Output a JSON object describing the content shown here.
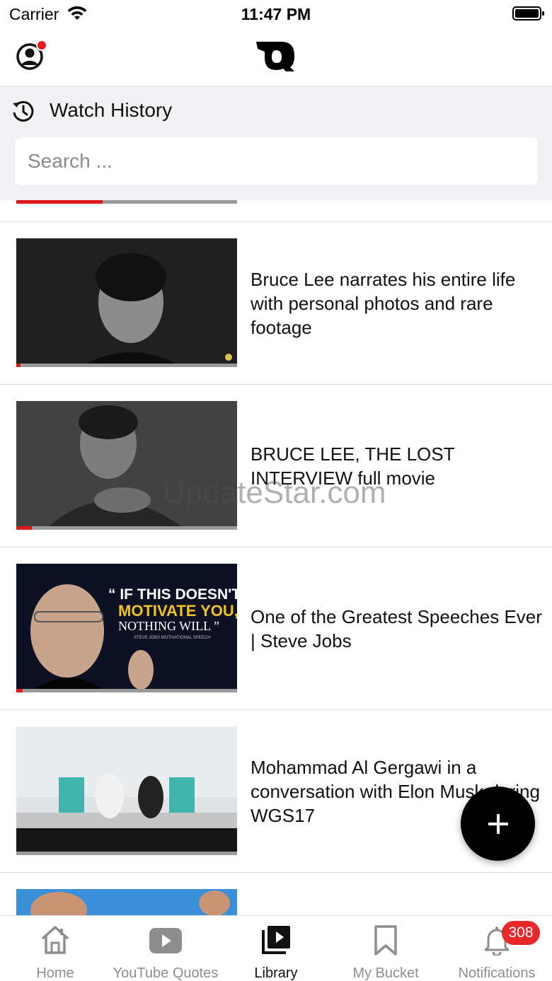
{
  "status_bar": {
    "carrier": "Carrier",
    "time": "11:47 PM"
  },
  "header": {
    "profile_icon": "user-circle-icon",
    "logo_icon": "app-logo-icon",
    "notification_dot_color": "#e81b1b"
  },
  "watch_history": {
    "title": "Watch History",
    "icon": "history-clock-icon"
  },
  "search": {
    "placeholder": "Search ..."
  },
  "partial_item": {
    "progress": 0.39
  },
  "videos": [
    {
      "title": "Bruce Lee narrates his entire life with personal photos and rare footage",
      "progress": 0.02
    },
    {
      "title": "BRUCE LEE, THE LOST INTERVIEW   full movie",
      "progress": 0.07
    },
    {
      "title": "One of the Greatest Speeches Ever | Steve Jobs",
      "progress": 0.03,
      "thumbnail_text": {
        "line1": "“ IF THIS DOESN'T",
        "line2": "MOTIVATE YOU,",
        "line3": "NOTHING WILL ”",
        "line4": "STEVE JOBS MOTIVATIONAL SPEECH"
      }
    },
    {
      "title": "Mohammad Al Gergawi in a conversation with Elon Musk during WGS17",
      "progress": 0
    }
  ],
  "watermark": "UpdateStar.com",
  "fab": {
    "icon": "plus-icon"
  },
  "tabs": [
    {
      "label": "Home",
      "icon": "home-icon",
      "active": false
    },
    {
      "label": "YouTube Quotes",
      "icon": "youtube-play-icon",
      "active": false
    },
    {
      "label": "Library",
      "icon": "library-playlist-icon",
      "active": true
    },
    {
      "label": "My Bucket",
      "icon": "bookmark-icon",
      "active": false
    },
    {
      "label": "Notifications",
      "icon": "bell-icon",
      "active": false
    }
  ],
  "notifications_badge": "308",
  "colors": {
    "accent_red": "#e01818",
    "badge_red": "#e8272b",
    "active_tab": "#111111",
    "inactive_tab": "#8e8e8e"
  }
}
